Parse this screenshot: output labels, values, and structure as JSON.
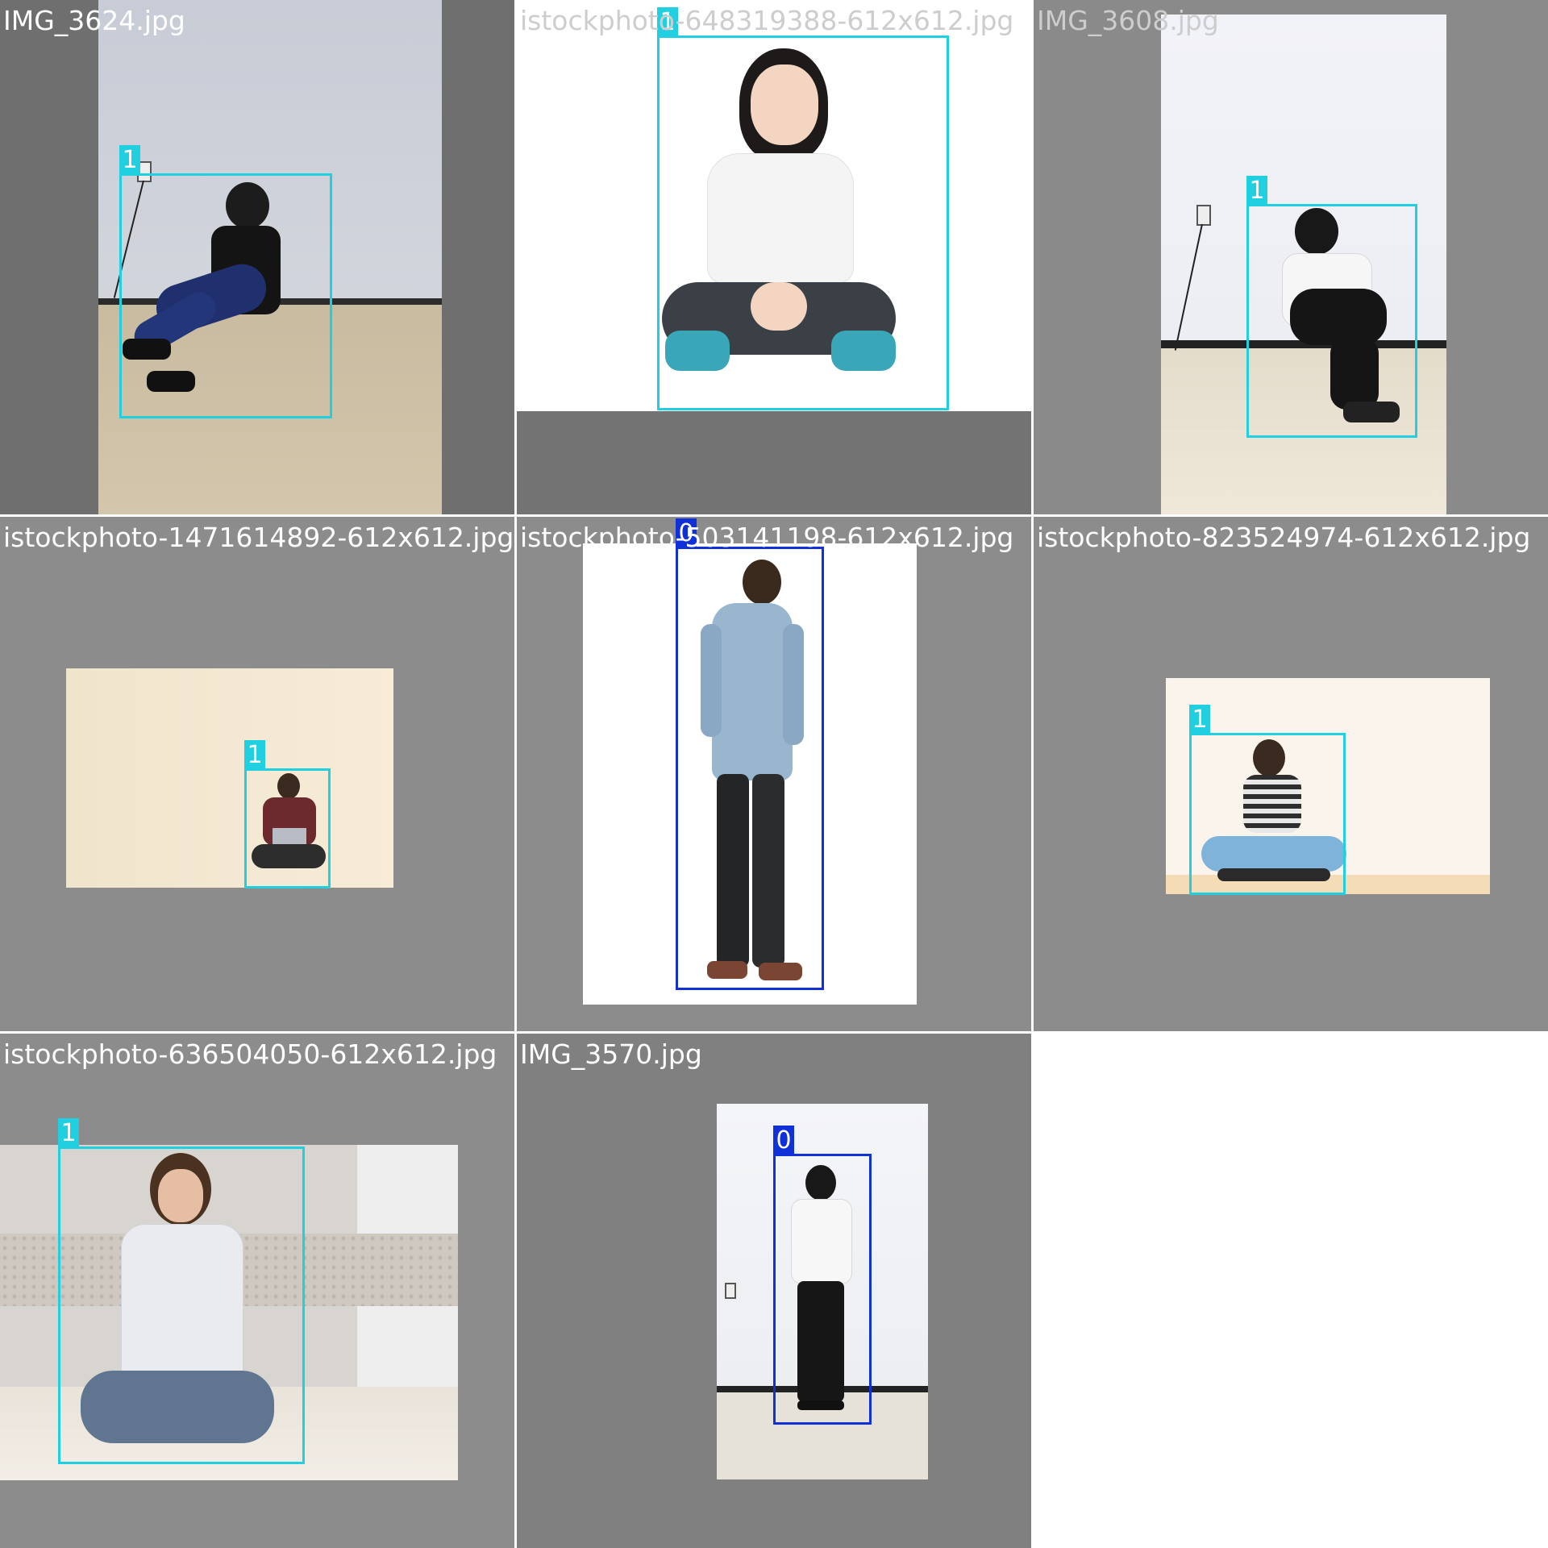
{
  "grid": {
    "background": "#ffffff",
    "tiles": [
      {
        "filename": "IMG_3624.jpg",
        "label_style": "white",
        "boxes": [
          {
            "class_label": "1",
            "class_color": "#20d0e0"
          }
        ]
      },
      {
        "filename": "istockphoto-648319388-612x612.jpg",
        "label_style": "light",
        "boxes": [
          {
            "class_label": "1",
            "class_color": "#20d0e0"
          }
        ]
      },
      {
        "filename": "IMG_3608.jpg",
        "label_style": "white",
        "boxes": [
          {
            "class_label": "1",
            "class_color": "#20d0e0"
          }
        ]
      },
      {
        "filename": "istockphoto-1471614892-612x612.jpg",
        "label_style": "white",
        "boxes": [
          {
            "class_label": "1",
            "class_color": "#20d0e0"
          }
        ]
      },
      {
        "filename": "istockphoto-503141198-612x612.jpg",
        "label_style": "white",
        "boxes": [
          {
            "class_label": "0",
            "class_color": "#1030d8"
          }
        ]
      },
      {
        "filename": "istockphoto-823524974-612x612.jpg",
        "label_style": "white",
        "boxes": [
          {
            "class_label": "1",
            "class_color": "#20d0e0"
          }
        ]
      },
      {
        "filename": "istockphoto-636504050-612x612.jpg",
        "label_style": "white",
        "boxes": [
          {
            "class_label": "1",
            "class_color": "#20d0e0"
          }
        ]
      },
      {
        "filename": "IMG_3570.jpg",
        "label_style": "white",
        "boxes": [
          {
            "class_label": "0",
            "class_color": "#1030d8"
          }
        ]
      }
    ]
  }
}
